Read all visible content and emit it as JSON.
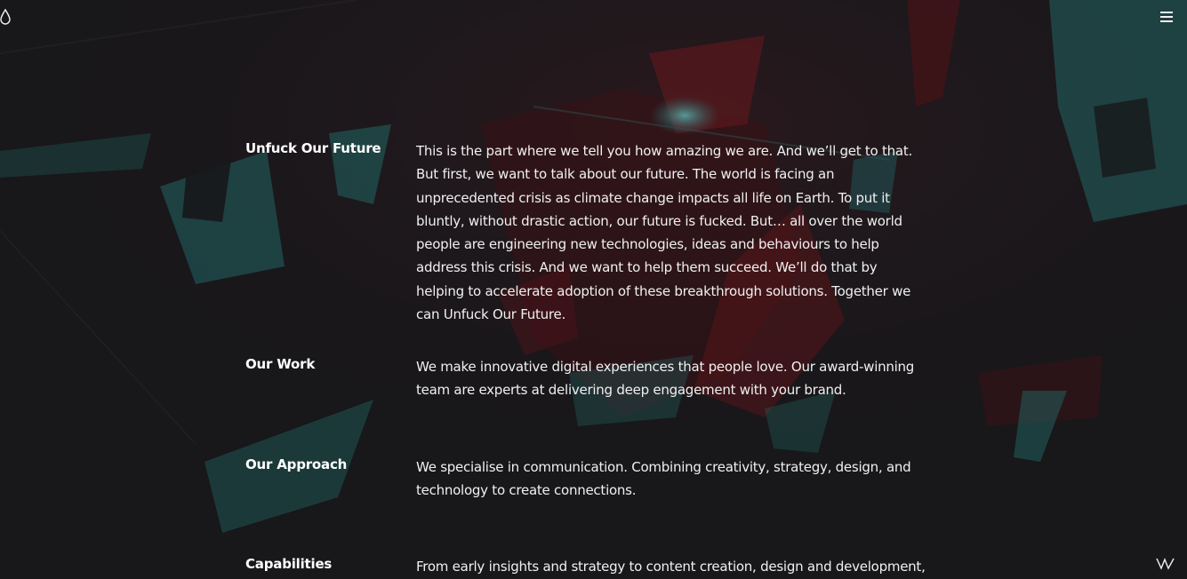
{
  "header": {
    "logo_icon": "droplet-icon",
    "menu_icon": "hamburger-menu-icon"
  },
  "sections": [
    {
      "title": "Unfuck Our Future",
      "body": "This is the part where we tell you how amazing we are. And we’ll get to that. But first, we want to talk about our future. The world is facing an unprecedented crisis as climate change impacts all life on Earth. To put it bluntly, without drastic action, our future is fucked. But… all over the world people are engineering new technologies, ideas and behaviours to help address this crisis. And we want to help them succeed. We’ll do that by helping to accelerate adoption of these breakthrough solutions. Together we can Unfuck Our Future."
    },
    {
      "title": "Our Work",
      "body": "We make innovative digital experiences that people love. Our award-winning team are experts at delivering deep engagement with your brand."
    },
    {
      "title": "Our Approach",
      "body": "We specialise in communication. Combining creativity, strategy, design, and technology to create connections."
    },
    {
      "title": "Capabilities",
      "body": "From early insights and strategy to content creation, design and development,"
    }
  ],
  "footer": {
    "corner_icon": "signature-mark-icon"
  },
  "colors": {
    "background": "#1b1a1d",
    "accent_teal": "#2a8f8c",
    "accent_red": "#8e1a1f",
    "text": "#f2f2f2"
  }
}
